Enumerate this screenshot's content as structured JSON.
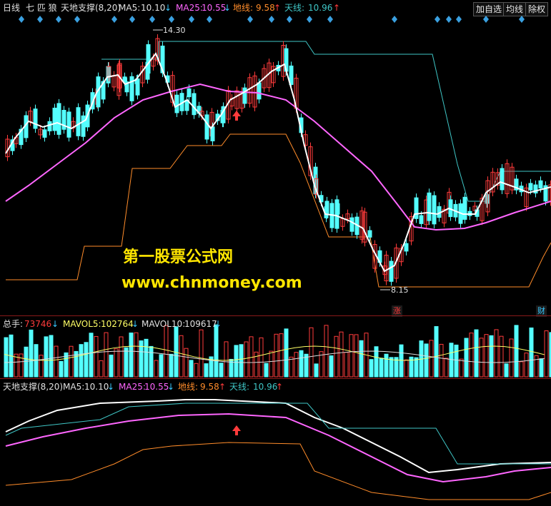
{
  "header": {
    "period": "日线",
    "title": "七 匹 狼",
    "indicator": "天地支撑(8,20)",
    "ma5_label": "MA5:",
    "ma5_value": "10.10",
    "ma25_label": "MA25:",
    "ma25_value": "10.55",
    "dixian_label": "地线:",
    "dixian_value": "9.58",
    "tianxian_label": "天线:",
    "tianxian_value": "10.96",
    "arrow_down": "↓",
    "arrow_up": "↑"
  },
  "toolbar": {
    "add_watchlist": "加自选",
    "ma_line": "均线",
    "ex_rights": "除权"
  },
  "price_chart": {
    "high_label": "14.30",
    "low_label": "8.15",
    "zhang_label": "涨",
    "cai_label": "财"
  },
  "watermark": {
    "line1": "第一股票公式网",
    "line2": "www.chnmoney.com"
  },
  "volume": {
    "total_label": "总手:",
    "total_value": "73746",
    "mavol5_label": "MAVOL5:",
    "mavol5_value": "102764",
    "mavol10_label": "MAVOL10:",
    "mavol10_value": "109617"
  },
  "indicator_panel": {
    "name": "天地支撑(8,20)",
    "ma5_label": "MA5:",
    "ma5_value": "10.10",
    "ma25_label": "MA25:",
    "ma25_value": "10.55",
    "dixian_label": "地线:",
    "dixian_value": "9.58",
    "tianxian_label": "天线:",
    "tianxian_value": "10.96"
  },
  "colors": {
    "up_candle": "#ff3b3b",
    "down_candle": "#54ffff",
    "ma5": "#ffffff",
    "ma25": "#ff66ff",
    "dixian": "#ff8c2a",
    "tianxian": "#3fc6c6",
    "background": "#000000"
  },
  "chart_data": {
    "type": "candlestick",
    "price_high_marked": 14.3,
    "price_low_marked": 8.15,
    "ma5_last": 10.1,
    "ma25_last": 10.55,
    "dixian_last": 9.58,
    "tianxian_last": 10.96,
    "volume_last": 73746,
    "mavol5_last": 102764,
    "mavol10_last": 109617
  }
}
